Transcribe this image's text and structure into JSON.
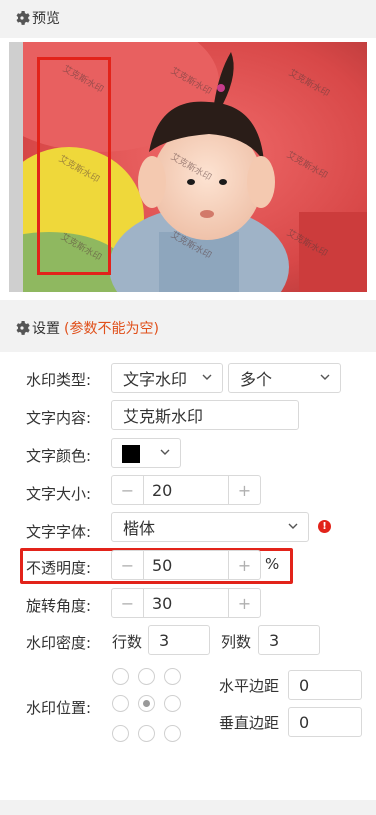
{
  "preview": {
    "title": "预览",
    "watermark_text": "艾克斯水印"
  },
  "settings": {
    "title": "设置",
    "hint": "(参数不能为空)",
    "watermark_type": {
      "label": "水印类型:",
      "value": "文字水印",
      "mode": "多个"
    },
    "text_content": {
      "label": "文字内容:",
      "value": "艾克斯水印"
    },
    "text_color": {
      "label": "文字颜色:",
      "swatch": "#000000"
    },
    "text_size": {
      "label": "文字大小:",
      "value": "20",
      "minus": "−",
      "plus": "+"
    },
    "text_font": {
      "label": "文字字体:",
      "value": "楷体",
      "warn_icon": "!"
    },
    "opacity": {
      "label": "不透明度:",
      "value": "50",
      "minus": "−",
      "plus": "+",
      "unit": "%"
    },
    "rotation": {
      "label": "旋转角度:",
      "value": "30",
      "minus": "−",
      "plus": "+"
    },
    "density": {
      "label": "水印密度:",
      "rows_label": "行数",
      "rows": "3",
      "cols_label": "列数",
      "cols": "3"
    },
    "position": {
      "label": "水印位置:",
      "selected": "center",
      "h_margin_label": "水平边距",
      "h_margin": "0",
      "v_margin_label": "垂直边距",
      "v_margin": "0"
    }
  },
  "colors": {
    "accent_red": "#e2231a",
    "hint_orange": "#e0501b"
  }
}
